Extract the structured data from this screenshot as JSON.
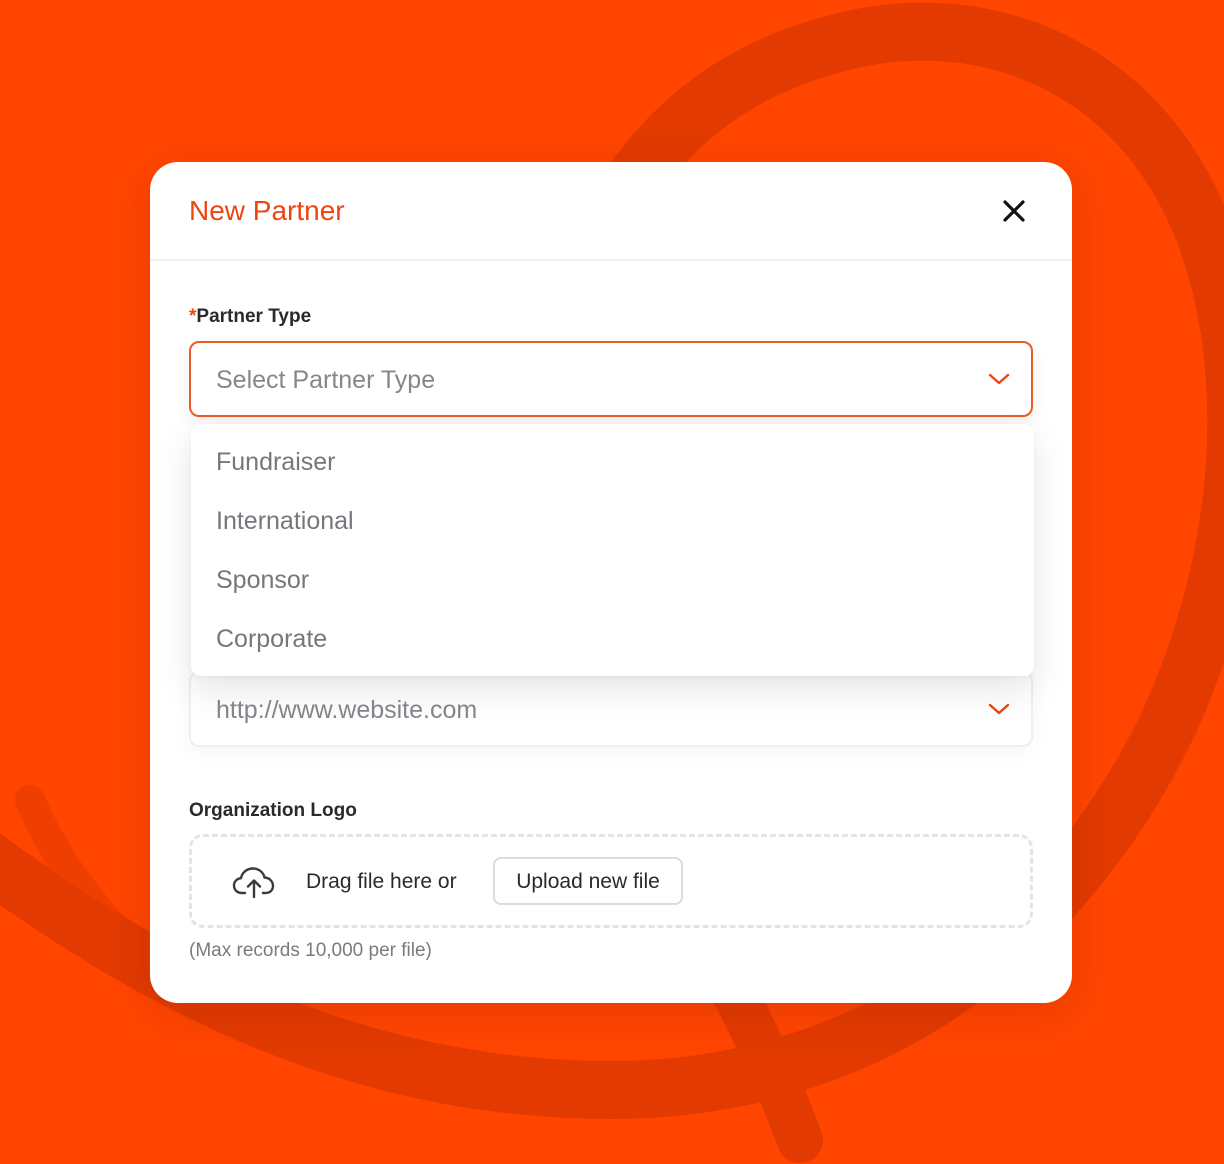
{
  "colors": {
    "background": "#FF4500",
    "swirl": "#E23A00",
    "accent": "#EE4511",
    "surface": "#FFFFFF"
  },
  "modal": {
    "title": "New Partner",
    "close_icon": "close-icon"
  },
  "partner_type": {
    "required_mark": "*",
    "label": "Partner Type",
    "placeholder": "Select Partner Type",
    "chevron_icon": "chevron-down-icon",
    "options": [
      "Fundraiser",
      "International",
      "Sponsor",
      "Corporate"
    ]
  },
  "website": {
    "placeholder": "http://www.website.com",
    "chevron_icon": "chevron-down-icon"
  },
  "logo": {
    "label": "Organization Logo",
    "upload_icon": "cloud-upload-icon",
    "drag_text": "Drag file here or",
    "upload_button": "Upload new file",
    "hint": "(Max records 10,000 per file)"
  }
}
